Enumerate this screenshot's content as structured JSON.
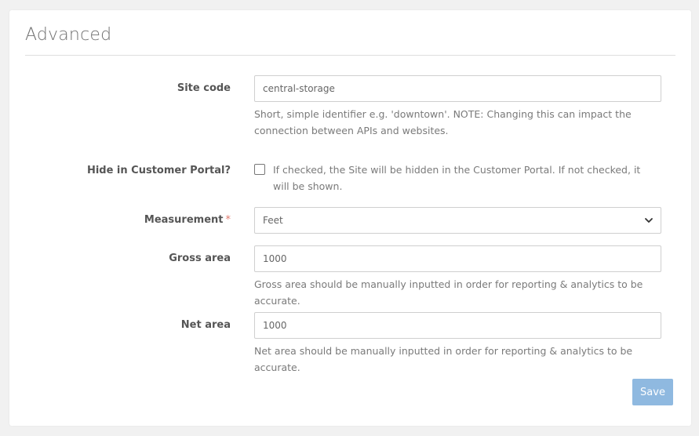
{
  "section": {
    "title": "Advanced"
  },
  "fields": {
    "site_code": {
      "label": "Site code",
      "value": "central-storage",
      "help": "Short, simple identifier e.g. 'downtown'. NOTE: Changing this can impact the connection between APIs and websites."
    },
    "hide_in_portal": {
      "label": "Hide in Customer Portal?",
      "checked": false,
      "help": "If checked, the Site will be hidden in the Customer Portal. If not checked, it will be shown."
    },
    "measurement": {
      "label": "Measurement",
      "required_mark": "*",
      "selected": "Feet"
    },
    "gross_area": {
      "label": "Gross area",
      "value": "1000",
      "help": "Gross area should be manually inputted in order for reporting & analytics to be accurate."
    },
    "net_area": {
      "label": "Net area",
      "value": "1000",
      "help": "Net area should be manually inputted in order for reporting & analytics to be accurate."
    }
  },
  "actions": {
    "save_label": "Save"
  },
  "colors": {
    "page_background": "#f1f1f1",
    "card_background": "#ffffff",
    "save_button": "#8fb9e0",
    "required_star": "#e07b6e"
  },
  "icons": {
    "select_chevron": "chevron-down-icon"
  }
}
